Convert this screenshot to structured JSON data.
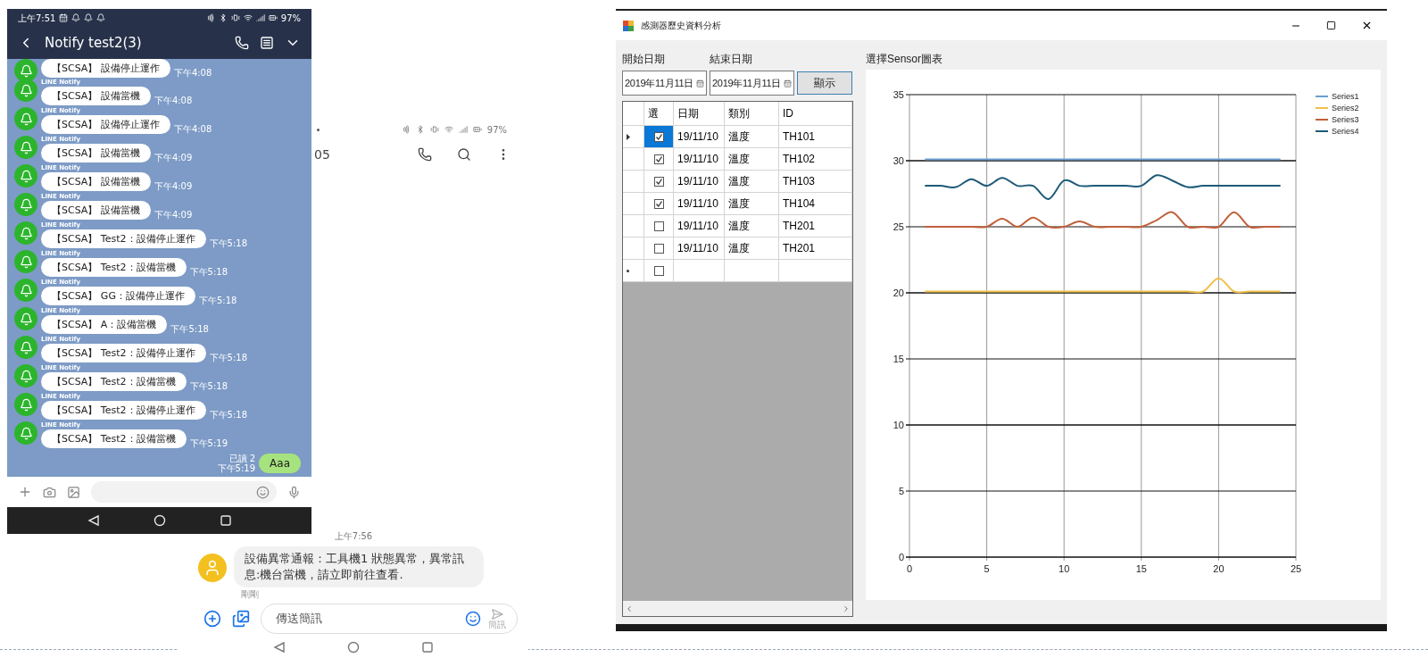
{
  "line_chat": {
    "status_time": "上午7:51",
    "battery": "97%",
    "title": "Notify test2(3)",
    "messages": [
      {
        "text": "【SCSA】 設備停止運作",
        "time": "下午4:08"
      },
      {
        "sender": "LINE Notify",
        "text": "【SCSA】 設備當機",
        "time": "下午4:08"
      },
      {
        "sender": "LINE Notify",
        "text": "【SCSA】 設備停止運作",
        "time": "下午4:08"
      },
      {
        "sender": "LINE Notify",
        "text": "【SCSA】 設備當機",
        "time": "下午4:09"
      },
      {
        "sender": "LINE Notify",
        "text": "【SCSA】 設備當機",
        "time": "下午4:09"
      },
      {
        "sender": "LINE Notify",
        "text": "【SCSA】 設備當機",
        "time": "下午4:09"
      },
      {
        "sender": "LINE Notify",
        "text": "【SCSA】 Test2：設備停止運作",
        "time": "下午5:18"
      },
      {
        "sender": "LINE Notify",
        "text": "【SCSA】 Test2：設備當機",
        "time": "下午5:18"
      },
      {
        "sender": "LINE Notify",
        "text": "【SCSA】 GG：設備停止運作",
        "time": "下午5:18"
      },
      {
        "sender": "LINE Notify",
        "text": "【SCSA】 A：設備當機",
        "time": "下午5:18"
      },
      {
        "sender": "LINE Notify",
        "text": "【SCSA】 Test2：設備停止運作",
        "time": "下午5:18"
      },
      {
        "sender": "LINE Notify",
        "text": "【SCSA】 Test2：設備當機",
        "time": "下午5:18"
      },
      {
        "sender": "LINE Notify",
        "text": "【SCSA】 Test2：設備停止運作",
        "time": "下午5:18"
      },
      {
        "sender": "LINE Notify",
        "text": "【SCSA】 Test2：設備當機",
        "time": "下午5:19"
      }
    ],
    "own_message": {
      "text": "Aaa",
      "read": "已讀 2",
      "time": "下午5:19"
    }
  },
  "sms_chat": {
    "battery": "97%",
    "title": "05",
    "time_divider": "上午7:56",
    "message": "設備異常通報：工具機1 狀態異常，異常訊息:機台當機，請立即前往查看.",
    "message_time": "剛剛",
    "input": {
      "placeholder": "傳送簡訊"
    },
    "send_label": "簡訊"
  },
  "analysis_window": {
    "title": "感測器歷史資料分析",
    "start_label": "開始日期",
    "end_label": "結束日期",
    "start_date": "2019年11月11日",
    "end_date": "2019年11月11日",
    "show_button": "顯示",
    "grid": {
      "columns": [
        "選",
        "日期",
        "類別",
        "ID"
      ],
      "rows": [
        {
          "checked": true,
          "selected": true,
          "date": "19/11/10",
          "type": "溫度",
          "id": "TH101"
        },
        {
          "checked": true,
          "selected": false,
          "date": "19/11/10",
          "type": "溫度",
          "id": "TH102"
        },
        {
          "checked": true,
          "selected": false,
          "date": "19/11/10",
          "type": "溫度",
          "id": "TH103"
        },
        {
          "checked": true,
          "selected": false,
          "date": "19/11/10",
          "type": "溫度",
          "id": "TH104"
        },
        {
          "checked": false,
          "selected": false,
          "date": "19/11/10",
          "type": "溫度",
          "id": "TH201"
        },
        {
          "checked": false,
          "selected": false,
          "date": "19/11/10",
          "type": "溫度",
          "id": "TH201"
        }
      ],
      "new_row": {
        "checked": false
      }
    },
    "chart_label": "選擇Sensor圖表",
    "chart_data": {
      "type": "line",
      "grid": true,
      "legend": true,
      "x": [
        1,
        2,
        3,
        4,
        5,
        6,
        7,
        8,
        9,
        10,
        11,
        12,
        13,
        14,
        15,
        16,
        17,
        18,
        19,
        20,
        21,
        22,
        23,
        24
      ],
      "xlim": [
        0,
        25
      ],
      "ylim": [
        0,
        35
      ],
      "xticks": [
        0,
        5,
        10,
        15,
        20,
        25
      ],
      "yticks": [
        0,
        5,
        10,
        15,
        20,
        25,
        30,
        35
      ],
      "series": [
        {
          "name": "Series1",
          "color": "#6a9fd0",
          "values": [
            30.1,
            30.1,
            30.1,
            30.1,
            30.1,
            30.1,
            30.1,
            30.1,
            30.1,
            30.1,
            30.1,
            30.1,
            30.1,
            30.1,
            30.1,
            30.1,
            30.1,
            30.1,
            30.1,
            30.1,
            30.1,
            30.1,
            30.1,
            30.1
          ]
        },
        {
          "name": "Series2",
          "color": "#f0c048",
          "values": [
            20.1,
            20.1,
            20.1,
            20.1,
            20.1,
            20.1,
            20.1,
            20.1,
            20.1,
            20.1,
            20.1,
            20.1,
            20.1,
            20.1,
            20.1,
            20.1,
            20.1,
            20.1,
            20.1,
            21.1,
            20.1,
            20.1,
            20.1,
            20.1
          ]
        },
        {
          "name": "Series3",
          "color": "#c0603a",
          "values": [
            25,
            25,
            25,
            25,
            25,
            25.6,
            25,
            25.7,
            25,
            25,
            25.4,
            25,
            25,
            25,
            25,
            25.5,
            26.1,
            25,
            25,
            25,
            26.1,
            25,
            25,
            25
          ]
        },
        {
          "name": "Series4",
          "color": "#1e5a78",
          "values": [
            28.1,
            28.1,
            28,
            28.6,
            28.1,
            28.7,
            28.1,
            28.1,
            27.1,
            28.5,
            28.1,
            28.1,
            28.1,
            28.1,
            28.1,
            28.9,
            28.5,
            28,
            28.1,
            28.1,
            28.1,
            28.1,
            28.1,
            28.1
          ]
        }
      ]
    }
  }
}
